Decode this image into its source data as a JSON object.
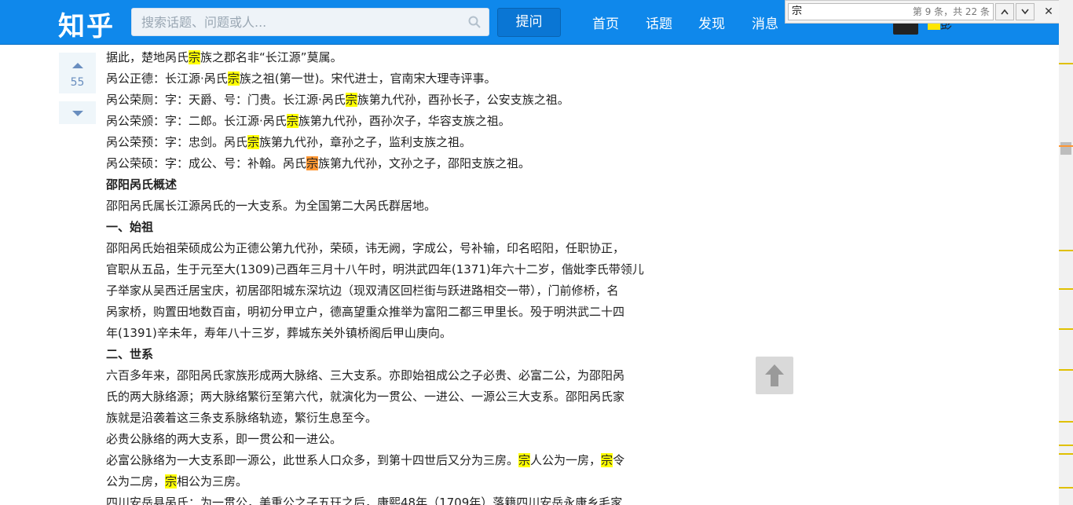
{
  "header": {
    "logo": "知乎",
    "search_placeholder": "搜索话题、问题或人...",
    "ask_label": "提问",
    "nav": [
      "首页",
      "话题",
      "发现",
      "消息"
    ],
    "user_name_fragment": "彭"
  },
  "findbar": {
    "query": "宗",
    "count_text": "第 9 条，共 22 条"
  },
  "vote": {
    "count": "55"
  },
  "content": {
    "lines": [
      {
        "parts": [
          "据此，楚地呙氏",
          "@宗",
          "族之郡名非“长江源”莫属。"
        ]
      },
      {
        "parts": [
          "呙公正德：长江源·呙氏",
          "@宗",
          "族之祖(第一世)。宋代进士，官南宋大理寺评事。"
        ]
      },
      {
        "parts": [
          "呙公荣厕：字：天爵、号：门贵。长江源·呙氏",
          "@宗",
          "族第九代孙，酉孙长子，公安支族之祖。"
        ]
      },
      {
        "parts": [
          "呙公荣颁：字：二郎。长江源·呙氏",
          "@宗",
          "族第九代孙，酉孙次子，华容支族之祖。"
        ]
      },
      {
        "parts": [
          "呙公荣预：字：忠剑。呙氏",
          "@宗",
          "族第九代孙，章孙之子，监利支族之祖。"
        ]
      },
      {
        "parts": [
          "呙公荣硕：字：成公、号：补翰。呙氏",
          "#宗",
          "族第九代孙，文孙之子，邵阳支族之祖。"
        ]
      },
      {
        "h": true,
        "parts": [
          "邵阳呙氏概述"
        ]
      },
      {
        "parts": [
          "邵阳呙氏属长江源呙氏的一大支系。为全国第二大呙氏群居地。"
        ]
      },
      {
        "h": true,
        "parts": [
          "一、始祖"
        ]
      },
      {
        "parts": [
          "邵阳呙氏始祖荣硕成公为正德公第九代孙，荣硕，讳无阙，字成公，号补输，印名昭阳，任职协正，"
        ]
      },
      {
        "parts": [
          "官职从五品，生于元至大(1309)己酉年三月十八午时，明洪武四年(1371)年六十二岁，偕妣李氏带领儿"
        ]
      },
      {
        "parts": [
          "子举家从吴西迁居宝庆，初居邵阳城东深坑边（现双清区回栏街与跃进路相交一带），门前修桥，名"
        ]
      },
      {
        "parts": [
          "呙家桥，购置田地数百亩，明初分甲立户，德高望重众推举为富阳二都三甲里长。殁于明洪武二十四"
        ]
      },
      {
        "parts": [
          "年(1391)辛未年，寿年八十三岁，葬城东关外镇桥阁后甲山庚向。"
        ]
      },
      {
        "h": true,
        "parts": [
          "二、世系"
        ]
      },
      {
        "parts": [
          "六百多年来，邵阳呙氏家族形成两大脉络、三大支系。亦即始祖成公之子必贵、必富二公，为邵阳呙"
        ]
      },
      {
        "parts": [
          "氏的两大脉络源；两大脉络繁衍至第六代，就演化为一贯公、一进公、一源公三大支系。邵阳呙氏家"
        ]
      },
      {
        "parts": [
          "族就是沿袭着这三条支系脉络轨迹，繁衍生息至今。"
        ]
      },
      {
        "parts": [
          "必贵公脉络的两大支系，即一贯公和一进公。"
        ]
      },
      {
        "parts": [
          "必富公脉络为一大支系即一源公，此世系人口众多，到第十四世后又分为三房。",
          "@宗",
          "人公为一房，",
          "@宗",
          "令"
        ]
      },
      {
        "parts": [
          "公为二房，",
          "@宗",
          "相公为三房。"
        ]
      },
      {
        "parts": [
          "四川安岳县呙氏：为一贯公，美重公之子五玨之后，康熙48年（1709年）落籍四川安岳永康乡毛家"
        ]
      }
    ]
  },
  "backtop_label": "back to top"
}
